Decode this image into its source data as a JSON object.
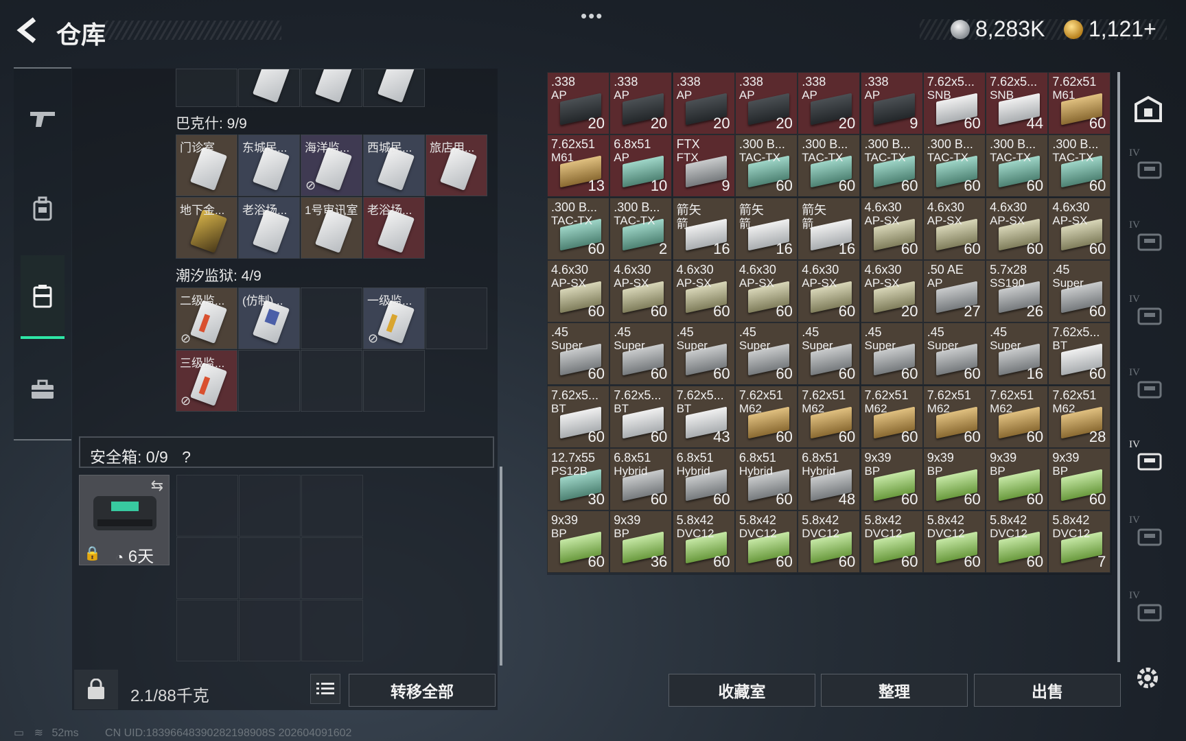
{
  "header": {
    "title": "仓库",
    "more_label": "•••",
    "currency_silver": "8,283K",
    "currency_gold": "1,121+"
  },
  "left_panel": {
    "top_partial_cards": 3,
    "section1": {
      "label": "巴克什: 9/9",
      "items": [
        {
          "label": "门诊室",
          "color": "tan"
        },
        {
          "label": "东城民...",
          "color": "blue"
        },
        {
          "label": "海洋监...",
          "color": "purple",
          "nolink": true
        },
        {
          "label": "西城民...",
          "color": "blue"
        },
        {
          "label": "旅店用...",
          "color": "red"
        },
        {
          "label": "地下金...",
          "color": "tan",
          "gold": true
        },
        {
          "label": "老浴场...",
          "color": "blue"
        },
        {
          "label": "1号审讯室",
          "color": "tan"
        },
        {
          "label": "老浴场...",
          "color": "red"
        }
      ]
    },
    "section2": {
      "label": "潮汐监狱: 4/9",
      "items": [
        {
          "label": "二级监...",
          "color": "tan",
          "mark": "red",
          "nolink": true
        },
        {
          "label": "(仿制)...",
          "color": "blue",
          "mark": "blue"
        },
        {
          "label": "",
          "color": "empty"
        },
        {
          "label": "一级监...",
          "color": "blue",
          "mark": "yel",
          "nolink": true
        },
        {
          "label": "",
          "color": "empty"
        },
        {
          "label": "三级监...",
          "color": "red",
          "mark": "red",
          "nolink": true
        },
        {
          "label": "",
          "color": "empty"
        },
        {
          "label": "",
          "color": "empty"
        },
        {
          "label": "",
          "color": "empty"
        }
      ]
    },
    "safe": {
      "label": "安全箱: 0/9",
      "help": "?",
      "days": "6天"
    },
    "weight": "2.1/88千克",
    "transfer_all": "转移全部"
  },
  "ammo_grid": [
    [
      [
        ".338",
        "AP",
        "20",
        "red",
        "dark"
      ],
      [
        ".338",
        "AP",
        "20",
        "red",
        "dark"
      ],
      [
        ".338",
        "AP",
        "20",
        "red",
        "dark"
      ],
      [
        ".338",
        "AP",
        "20",
        "red",
        "dark"
      ],
      [
        ".338",
        "AP",
        "20",
        "red",
        "dark"
      ],
      [
        ".338",
        "AP",
        "9",
        "red",
        "dark"
      ],
      [
        "7.62x5...",
        "SNB",
        "60",
        "red",
        "white"
      ],
      [
        "7.62x5...",
        "SNB",
        "44",
        "red",
        "white"
      ],
      [
        "7.62x51",
        "M61",
        "60",
        "red",
        "tanb"
      ]
    ],
    [
      [
        "7.62x51",
        "M61",
        "13",
        "red",
        "tanb"
      ],
      [
        "6.8x51",
        "AP",
        "10",
        "red",
        "teal"
      ],
      [
        "FTX",
        "FTX",
        "9",
        "red",
        "gray"
      ],
      [
        ".300 B...",
        "TAC-TX",
        "60",
        "tan",
        "teal"
      ],
      [
        ".300 B...",
        "TAC-TX",
        "60",
        "tan",
        "teal"
      ],
      [
        ".300 B...",
        "TAC-TX",
        "60",
        "tan",
        "teal"
      ],
      [
        ".300 B...",
        "TAC-TX",
        "60",
        "tan",
        "teal"
      ],
      [
        ".300 B...",
        "TAC-TX",
        "60",
        "tan",
        "teal"
      ],
      [
        ".300 B...",
        "TAC-TX",
        "60",
        "tan",
        "teal"
      ]
    ],
    [
      [
        ".300 B...",
        "TAC-TX",
        "60",
        "tan",
        "teal"
      ],
      [
        ".300 B...",
        "TAC-TX",
        "2",
        "tan",
        "teal"
      ],
      [
        "箭矢",
        "箭...",
        "16",
        "tan",
        "white"
      ],
      [
        "箭矢",
        "箭...",
        "16",
        "tan",
        "white"
      ],
      [
        "箭矢",
        "箭...",
        "16",
        "tan",
        "white"
      ],
      [
        "4.6x30",
        "AP-SX",
        "60",
        "tan",
        "olive"
      ],
      [
        "4.6x30",
        "AP-SX",
        "60",
        "tan",
        "olive"
      ],
      [
        "4.6x30",
        "AP-SX",
        "60",
        "tan",
        "olive"
      ],
      [
        "4.6x30",
        "AP-SX",
        "60",
        "tan",
        "olive"
      ]
    ],
    [
      [
        "4.6x30",
        "AP-SX",
        "60",
        "tan",
        "olive"
      ],
      [
        "4.6x30",
        "AP-SX",
        "60",
        "tan",
        "olive"
      ],
      [
        "4.6x30",
        "AP-SX",
        "60",
        "tan",
        "olive"
      ],
      [
        "4.6x30",
        "AP-SX",
        "60",
        "tan",
        "olive"
      ],
      [
        "4.6x30",
        "AP-SX",
        "60",
        "tan",
        "olive"
      ],
      [
        "4.6x30",
        "AP-SX",
        "20",
        "tan",
        "olive"
      ],
      [
        ".50 AE",
        "AP",
        "27",
        "tan",
        "gray"
      ],
      [
        "5.7x28",
        "SS190",
        "26",
        "tan",
        "gray"
      ],
      [
        ".45",
        "Super",
        "60",
        "tan",
        "gray"
      ]
    ],
    [
      [
        ".45",
        "Super",
        "60",
        "tan",
        "gray"
      ],
      [
        ".45",
        "Super",
        "60",
        "tan",
        "gray"
      ],
      [
        ".45",
        "Super",
        "60",
        "tan",
        "gray"
      ],
      [
        ".45",
        "Super",
        "60",
        "tan",
        "gray"
      ],
      [
        ".45",
        "Super",
        "60",
        "tan",
        "gray"
      ],
      [
        ".45",
        "Super",
        "60",
        "tan",
        "gray"
      ],
      [
        ".45",
        "Super",
        "60",
        "tan",
        "gray"
      ],
      [
        ".45",
        "Super",
        "16",
        "tan",
        "gray"
      ],
      [
        "7.62x5...",
        "BT",
        "60",
        "tan",
        "white"
      ]
    ],
    [
      [
        "7.62x5...",
        "BT",
        "60",
        "tan",
        "white"
      ],
      [
        "7.62x5...",
        "BT",
        "60",
        "tan",
        "white"
      ],
      [
        "7.62x5...",
        "BT",
        "43",
        "tan",
        "white"
      ],
      [
        "7.62x51",
        "M62",
        "60",
        "tan",
        "tanb"
      ],
      [
        "7.62x51",
        "M62",
        "60",
        "tan",
        "tanb"
      ],
      [
        "7.62x51",
        "M62",
        "60",
        "tan",
        "tanb"
      ],
      [
        "7.62x51",
        "M62",
        "60",
        "tan",
        "tanb"
      ],
      [
        "7.62x51",
        "M62",
        "60",
        "tan",
        "tanb"
      ],
      [
        "7.62x51",
        "M62",
        "28",
        "tan",
        "tanb"
      ]
    ],
    [
      [
        "12.7x55",
        "PS12B",
        "30",
        "tan",
        "teal"
      ],
      [
        "6.8x51",
        "Hybrid",
        "60",
        "tan",
        "gray"
      ],
      [
        "6.8x51",
        "Hybrid",
        "60",
        "tan",
        "gray"
      ],
      [
        "6.8x51",
        "Hybrid",
        "60",
        "tan",
        "gray"
      ],
      [
        "6.8x51",
        "Hybrid",
        "48",
        "tan",
        "gray"
      ],
      [
        "9x39",
        "BP",
        "60",
        "tan",
        "green"
      ],
      [
        "9x39",
        "BP",
        "60",
        "tan",
        "green"
      ],
      [
        "9x39",
        "BP",
        "60",
        "tan",
        "green"
      ],
      [
        "9x39",
        "BP",
        "60",
        "tan",
        "green"
      ]
    ],
    [
      [
        "9x39",
        "BP",
        "60",
        "tan",
        "green"
      ],
      [
        "9x39",
        "BP",
        "36",
        "tan",
        "green"
      ],
      [
        "5.8x42",
        "DVC12",
        "60",
        "tan",
        "green"
      ],
      [
        "5.8x42",
        "DVC12",
        "60",
        "tan",
        "green"
      ],
      [
        "5.8x42",
        "DVC12",
        "60",
        "tan",
        "green"
      ],
      [
        "5.8x42",
        "DVC12",
        "60",
        "tan",
        "green"
      ],
      [
        "5.8x42",
        "DVC12",
        "60",
        "tan",
        "green"
      ],
      [
        "5.8x42",
        "DVC12",
        "60",
        "tan",
        "green"
      ],
      [
        "5.8x42",
        "DVC12",
        "7",
        "tan",
        "green"
      ]
    ]
  ],
  "bottom_buttons": {
    "collection": "收藏室",
    "organize": "整理",
    "sell": "出售"
  },
  "right_nav": {
    "tier_label": "IV"
  },
  "status": {
    "ping": "52ms",
    "uid": "CN UID:18396648390282198908S 202604091602"
  }
}
